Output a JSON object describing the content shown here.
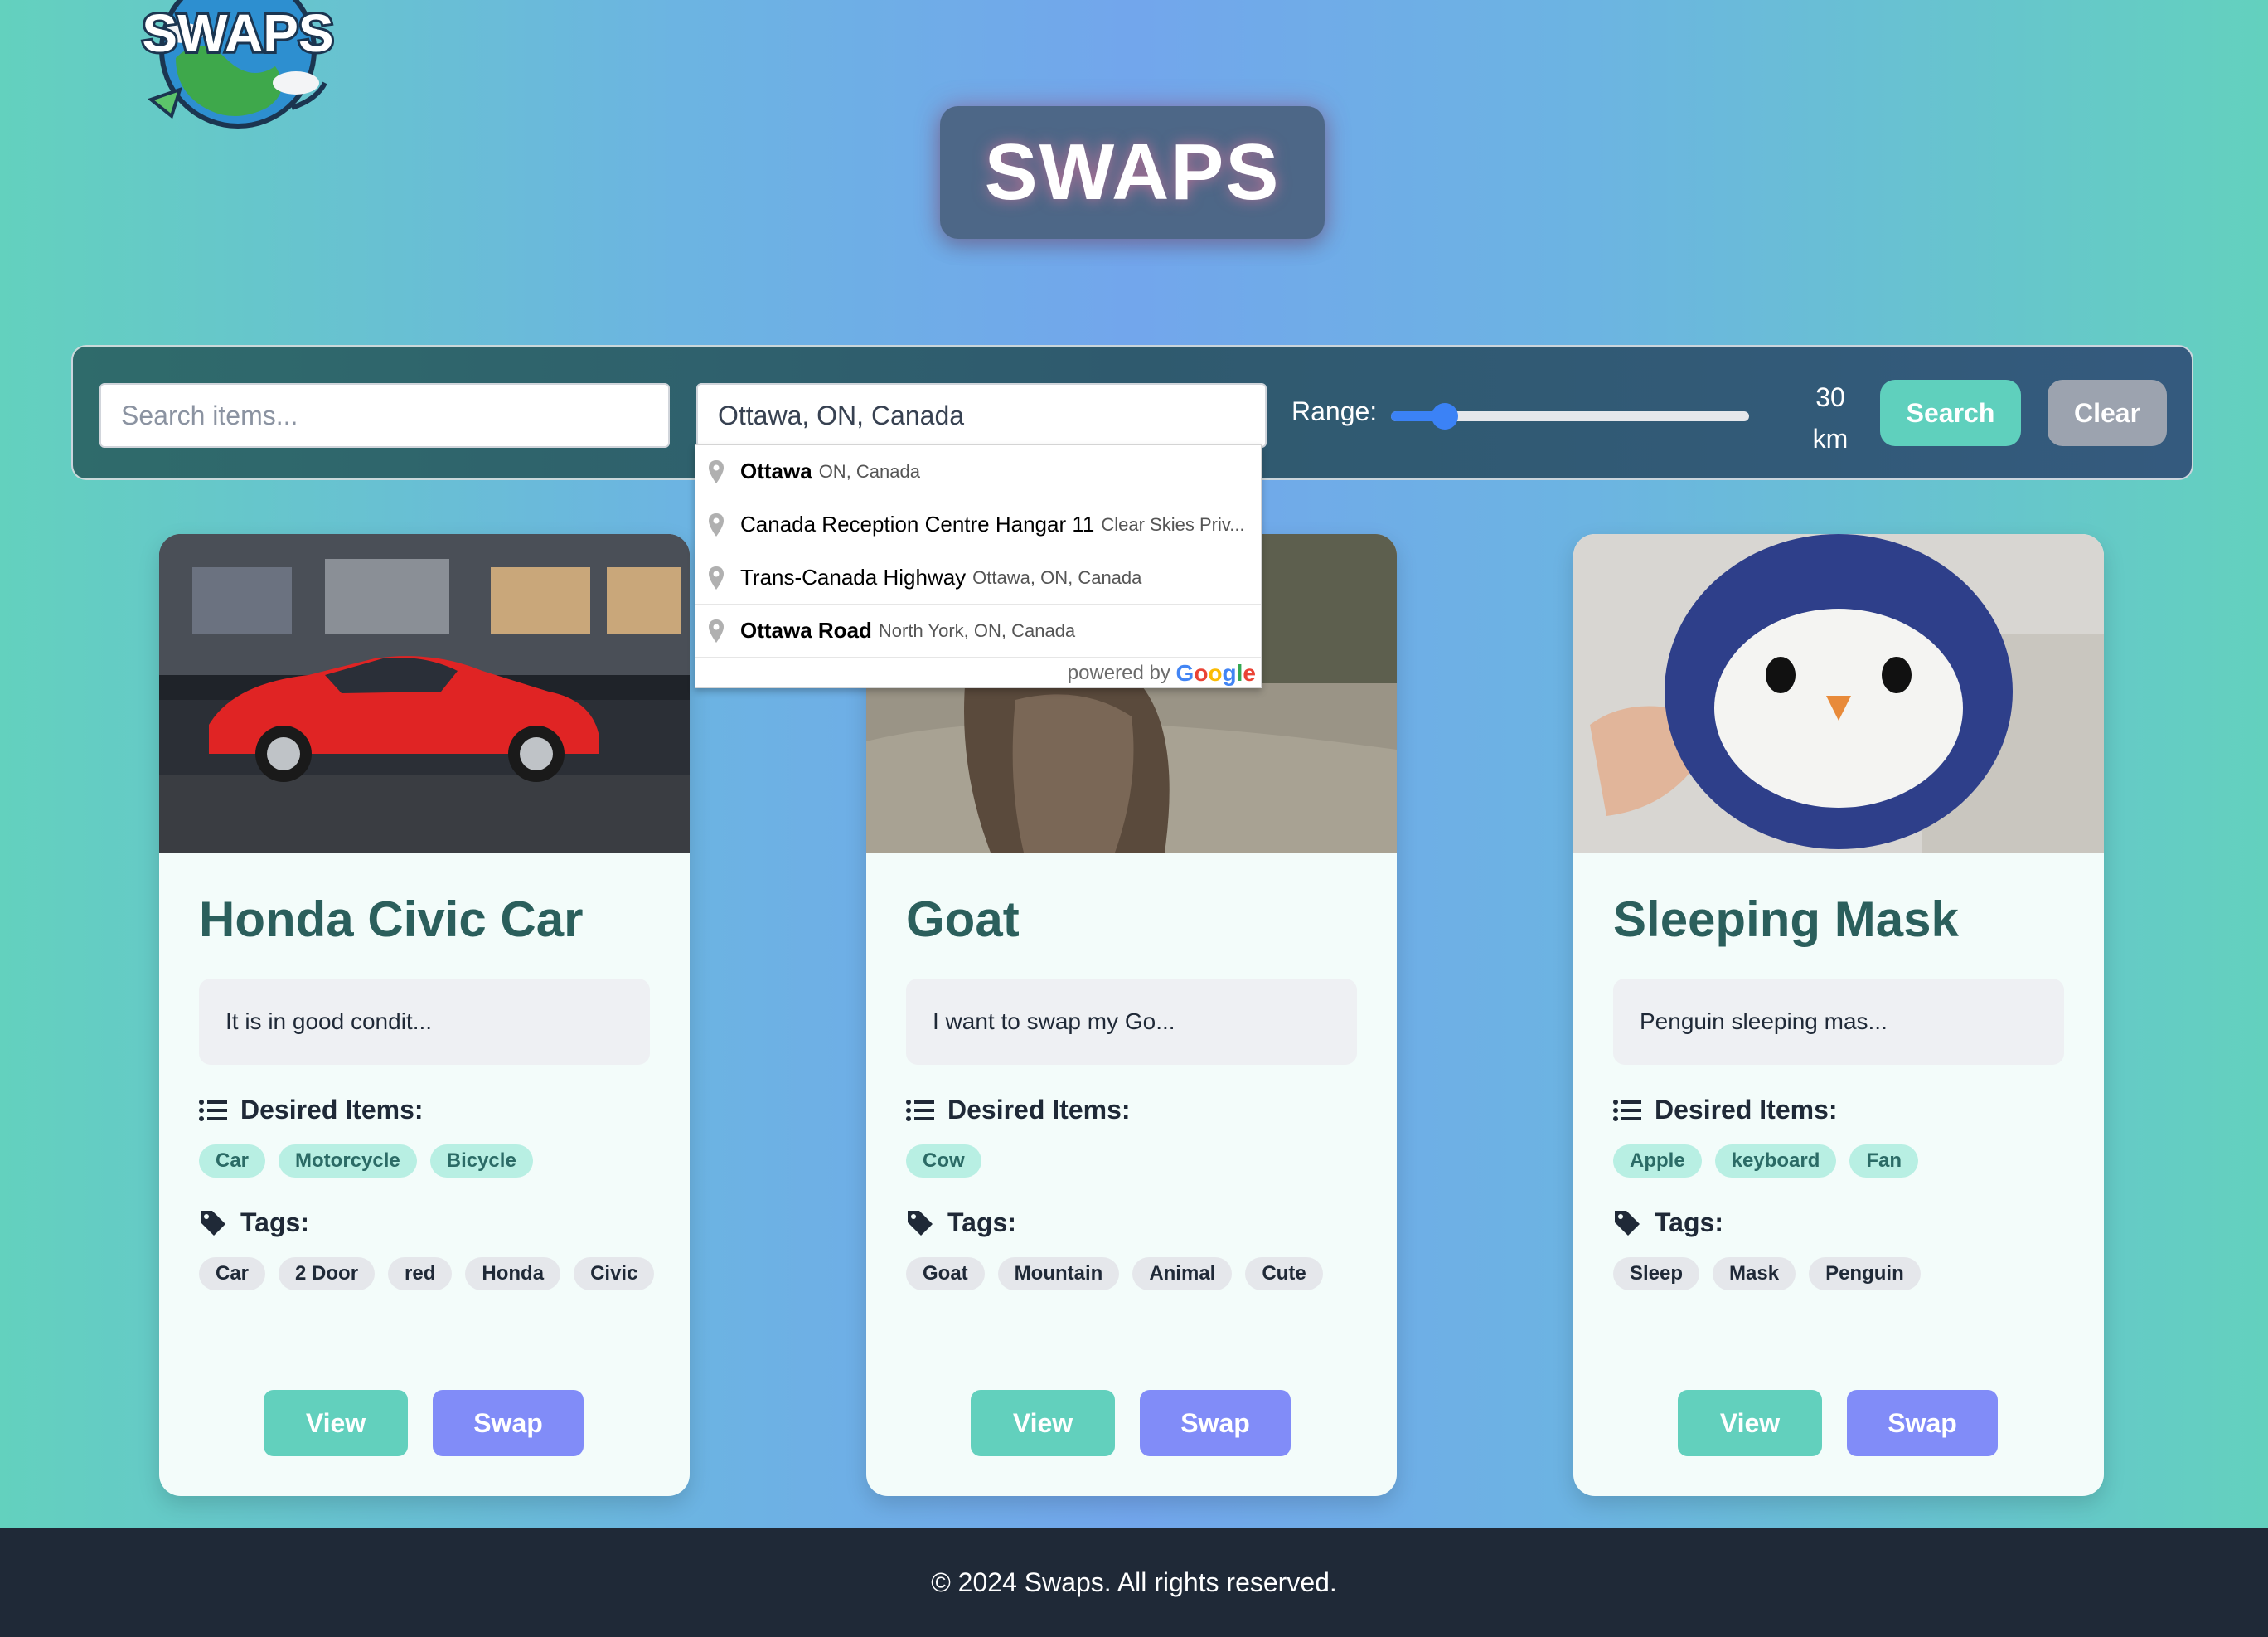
{
  "brand": {
    "logo_text": "SWAPS",
    "title": "SWAPS"
  },
  "search": {
    "items_placeholder": "Search items...",
    "location_value": "Ottawa, ON, Canada",
    "range_label": "Range:",
    "range_value": "30",
    "range_unit": "km",
    "range_fraction": 0.15,
    "search_label": "Search",
    "clear_label": "Clear"
  },
  "autocomplete": {
    "items": [
      {
        "main": "Ottawa",
        "secondary": "ON, Canada"
      },
      {
        "main": "Canada Reception Centre Hangar 11",
        "secondary": "Clear Skies Priv..."
      },
      {
        "main": "Trans-Canada Highway",
        "secondary": "Ottawa, ON, Canada"
      },
      {
        "main": "Ottawa Road",
        "secondary": "North York, ON, Canada"
      }
    ],
    "powered_by": "powered by",
    "google": "Google"
  },
  "labels": {
    "desired": "Desired Items:",
    "tags": "Tags:",
    "view": "View",
    "swap": "Swap"
  },
  "cards": [
    {
      "title": "Honda Civic Car",
      "description": "It is in good condit...",
      "desired": [
        "Car",
        "Motorcycle",
        "Bicycle"
      ],
      "tags": [
        "Car",
        "2 Door",
        "red",
        "Honda",
        "Civic"
      ]
    },
    {
      "title": "Goat",
      "description": "I want to swap my Go...",
      "desired": [
        "Cow"
      ],
      "tags": [
        "Goat",
        "Mountain",
        "Animal",
        "Cute"
      ]
    },
    {
      "title": "Sleeping Mask",
      "description": "Penguin sleeping mas...",
      "desired": [
        "Apple",
        "keyboard",
        "Fan"
      ],
      "tags": [
        "Sleep",
        "Mask",
        "Penguin"
      ]
    }
  ],
  "footer": {
    "text": "© 2024 Swaps. All rights reserved."
  },
  "colors": {
    "accent": "#62d0bd",
    "swap": "#818cf8",
    "title_box": "#4d6787",
    "footer": "#1f2937"
  }
}
